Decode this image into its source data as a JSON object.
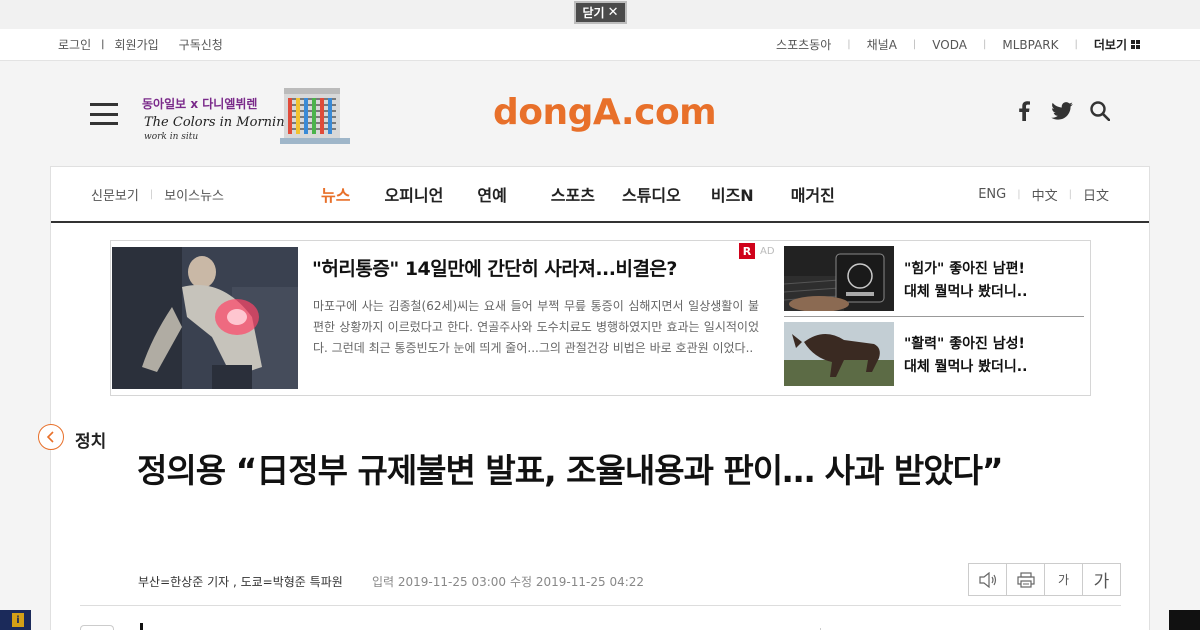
{
  "close_bar": {
    "label": "닫기",
    "close_glyph": "✕"
  },
  "util_bar": {
    "left": [
      "로그인",
      "회원가입",
      "구독신청"
    ],
    "right": [
      "스포츠동아",
      "채널A",
      "VODA",
      "MLBPARK"
    ],
    "more_label": "더보기"
  },
  "header": {
    "logo": "dongA.com",
    "banner": {
      "line1": "동아일보 x 다니엘뷔렌",
      "line2": "The Colors in Morning Calm",
      "line3": "work in situ"
    },
    "icons": [
      "menu-icon",
      "facebook-icon",
      "twitter-icon",
      "search-icon"
    ]
  },
  "gnb": {
    "left": [
      "신문보기",
      "보이스뉴스"
    ],
    "center": [
      "뉴스",
      "오피니언",
      "연예",
      "스포츠",
      "스튜디오",
      "비즈N",
      "매거진"
    ],
    "right": [
      "ENG",
      "中文",
      "日文"
    ],
    "active": "뉴스",
    "active_color": "#e8702a"
  },
  "ad": {
    "badge": "R",
    "label": "AD",
    "headline": "\"허리통증\" 14일만에 간단히 사라져...비결은?",
    "body": "마포구에 사는 김종철(62세)씨는 요새 들어 부쩍 무릎 통증이 심해지면서 일상생활이 불편한 상황까지 이르렀다고 한다. 연골주사와 도수치료도 병행하였지만 효과는 일시적이었다. 그런데 최근 통증빈도가 눈에 띄게 줄어...그의 관절건강 비법은 바로 호관원 이었다..",
    "side1_line1": "\"힘가\" 좋아진 남편!",
    "side1_line2": "대체 뭘먹나 봤더니..",
    "side2_line1": "\"활력\" 좋아진 남성!",
    "side2_line2": "대체 뭘먹나 봤더니.."
  },
  "article": {
    "section": "정치",
    "title": "정의용 “日정부 규제불변 발표, 조율내용과 판이… 사과 받았다”",
    "byline": "부산=한상준 기자 , 도쿄=박형준 특파원",
    "input_date": "입력 2019-11-25 03:00",
    "modified_date": "수정 2019-11-25 04:22",
    "tools": {
      "font_small": "가",
      "font_big": "가"
    }
  },
  "colors": {
    "brand": "#e8702a",
    "ad_badge": "#d0021b"
  }
}
